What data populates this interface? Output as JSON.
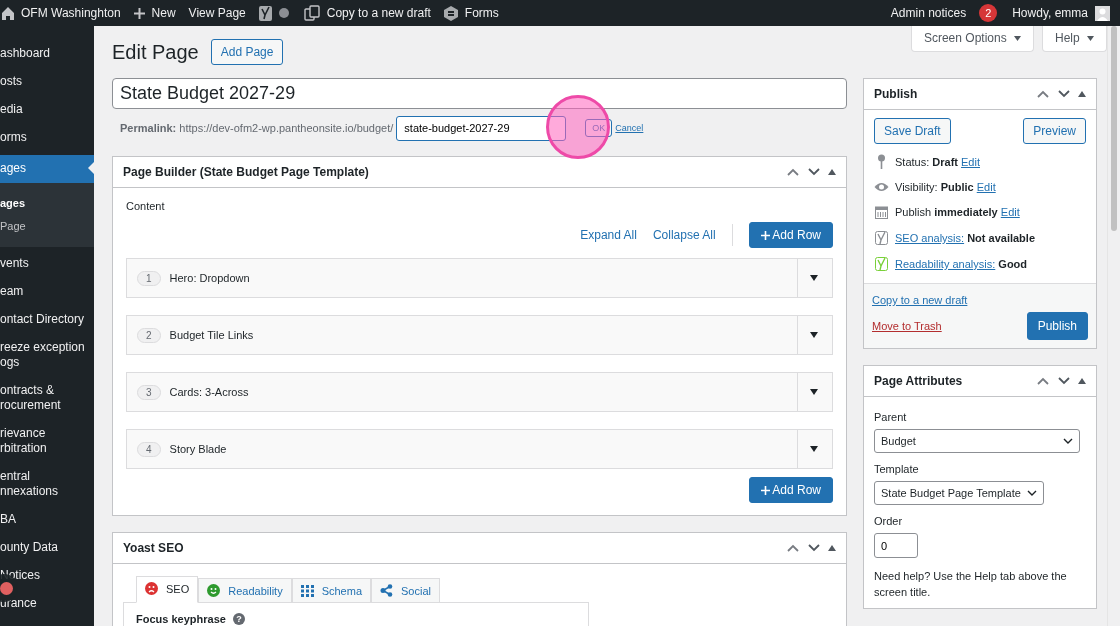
{
  "admin_bar": {
    "site": "OFM Washinghton",
    "new": "New",
    "view": "View Page",
    "copy": "Copy to a new draft",
    "forms": "Forms",
    "notices": "Admin notices",
    "notices_count": "2",
    "howdy": "Howdy, emma"
  },
  "sidebar": {
    "items": [
      {
        "label": "ashboard",
        "selected": false
      },
      {
        "label": "osts",
        "selected": false
      },
      {
        "label": "edia",
        "selected": false
      },
      {
        "label": "orms",
        "selected": false
      },
      {
        "label": "ages",
        "selected": true,
        "children": [
          {
            "label": "ages",
            "selected": true
          },
          {
            "label": "Page",
            "selected": false
          }
        ]
      },
      {
        "label": "vents",
        "selected": false
      },
      {
        "label": "eam",
        "selected": false
      },
      {
        "label": "ontact Directory",
        "selected": false
      },
      {
        "label": "reeze exception ogs",
        "selected": false
      },
      {
        "label": "ontracts & rocurement",
        "selected": false
      },
      {
        "label": "rievance rbitration",
        "selected": false
      },
      {
        "label": "entral nnexations",
        "selected": false
      },
      {
        "label": "BA",
        "selected": false
      },
      {
        "label": "ounty Data",
        "selected": false
      },
      {
        "label": "Notices",
        "selected": false
      },
      {
        "label": "urance",
        "selected": false
      }
    ]
  },
  "screen_tabs": [
    "Screen Options",
    "Help"
  ],
  "heading": "Edit Page",
  "add_page": "Add Page",
  "title_field": {
    "value": "State Budget 2027-29"
  },
  "permalink": {
    "label": "Permalink:",
    "base": "https://dev-ofm2-wp.pantheonsite.io/budget/",
    "slug": "state-budget-2027-29",
    "ok": "OK",
    "cancel": "Cancel"
  },
  "page_builder": {
    "title": "Page Builder (State Budget Page Template)",
    "content_label": "Content",
    "expand": "Expand All",
    "collapse": "Collapse All",
    "add_row": "Add Row",
    "add_row_bottom": "Add Row",
    "rows": [
      {
        "number": "1",
        "label": "Hero: Dropdown"
      },
      {
        "number": "2",
        "label": "Budget Tile Links"
      },
      {
        "number": "3",
        "label": "Cards: 3-Across"
      },
      {
        "number": "4",
        "label": "Story Blade"
      }
    ]
  },
  "yoast": {
    "title": "Yoast SEO",
    "tabs": [
      {
        "label": "SEO",
        "kind": "sad",
        "selected": true
      },
      {
        "label": "Readability",
        "kind": "smile",
        "selected": false
      },
      {
        "label": "Schema",
        "kind": "grid",
        "selected": false
      },
      {
        "label": "Social",
        "kind": "share",
        "selected": false
      }
    ],
    "focus_label": "Focus keyphrase",
    "help_icon": "?"
  },
  "publish": {
    "title": "Publish",
    "save_draft": "Save Draft",
    "preview": "Preview",
    "items": [
      {
        "kind": "status",
        "label": "Status:",
        "value": "Draft",
        "link": "Edit"
      },
      {
        "kind": "visibility",
        "label": "Visibility:",
        "value": "Public",
        "link": "Edit"
      },
      {
        "kind": "schedule",
        "label": "Publish",
        "value": "immediately",
        "link": "Edit"
      },
      {
        "kind": "seo",
        "link": "SEO analysis:",
        "value": "Not available"
      },
      {
        "kind": "readability",
        "link": "Readability analysis:",
        "value": "Good"
      }
    ],
    "copy_link": "Copy to a new draft",
    "trash": "Move to Trash",
    "publish": "Publish"
  },
  "page_attributes": {
    "title": "Page Attributes",
    "parent_label": "Parent",
    "parent_value": "Budget",
    "template_label": "Template",
    "template_value": "State Budget Page Template",
    "order_label": "Order",
    "order_value": "0",
    "help": "Need help? Use the Help tab above the screen title."
  }
}
